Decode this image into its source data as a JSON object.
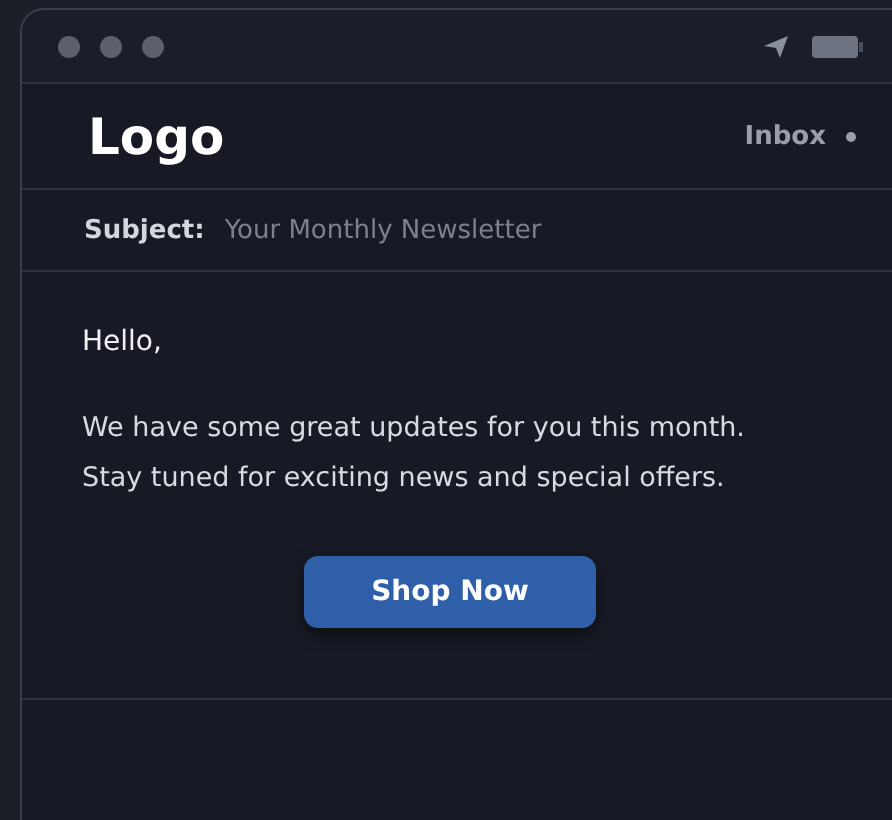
{
  "header": {
    "logo": "Logo",
    "folder": "Inbox"
  },
  "subject": {
    "label": "Subject:",
    "value": "Your Monthly Newsletter"
  },
  "body": {
    "greeting": "Hello,",
    "lines": [
      "We have some great updates for you this month.",
      "Stay tuned for exciting news and special offers."
    ],
    "button": "Shop Now"
  }
}
